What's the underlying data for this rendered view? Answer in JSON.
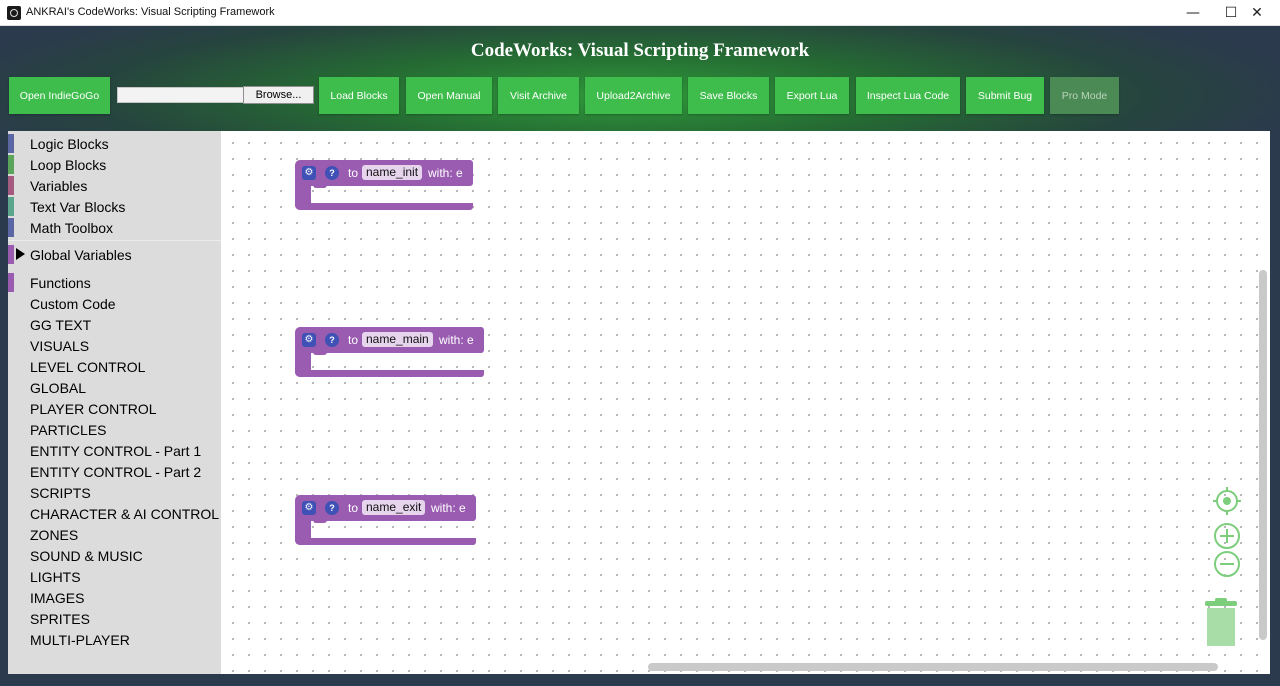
{
  "window": {
    "title": "ANKRAI's  CodeWorks: Visual Scripting Framework",
    "minimize": "—",
    "maximize": "☐",
    "close": "✕"
  },
  "header": {
    "title": "CodeWorks: Visual Scripting Framework"
  },
  "toolbar": {
    "open_indiegogo": "Open IndieGoGo",
    "file_value": "",
    "browse": "Browse...",
    "load_blocks": "Load Blocks",
    "open_manual": "Open Manual",
    "visit_archive": "Visit Archive",
    "upload2archive": "Upload2Archive",
    "save_blocks": "Save Blocks",
    "export_lua": "Export Lua",
    "inspect_lua": "Inspect Lua Code",
    "submit_bug": "Submit Bug",
    "pro_mode": "Pro Mode"
  },
  "sidebar": {
    "items": [
      {
        "label": "Logic Blocks",
        "color": "#5b67a5"
      },
      {
        "label": "Loop Blocks",
        "color": "#5ba55b"
      },
      {
        "label": "Variables",
        "color": "#a55b80"
      },
      {
        "label": "Text Var Blocks",
        "color": "#5ba58c"
      },
      {
        "label": "Math Toolbox",
        "color": "#5b67a5"
      },
      {
        "label": "Global Variables",
        "color": ""
      },
      {
        "label": "Functions",
        "color": "#9a5cb0"
      },
      {
        "label": "Custom Code",
        "color": ""
      },
      {
        "label": "GG TEXT",
        "color": ""
      },
      {
        "label": "VISUALS",
        "color": ""
      },
      {
        "label": "LEVEL CONTROL",
        "color": ""
      },
      {
        "label": "GLOBAL",
        "color": ""
      },
      {
        "label": "PLAYER CONTROL",
        "color": ""
      },
      {
        "label": "PARTICLES",
        "color": ""
      },
      {
        "label": "ENTITY CONTROL - Part 1",
        "color": ""
      },
      {
        "label": "ENTITY CONTROL - Part 2",
        "color": ""
      },
      {
        "label": "SCRIPTS",
        "color": ""
      },
      {
        "label": "CHARACTER & AI CONTROL",
        "color": ""
      },
      {
        "label": "ZONES",
        "color": ""
      },
      {
        "label": "SOUND & MUSIC",
        "color": ""
      },
      {
        "label": "LIGHTS",
        "color": ""
      },
      {
        "label": "IMAGES",
        "color": ""
      },
      {
        "label": "SPRITES",
        "color": ""
      },
      {
        "label": "MULTI-PLAYER",
        "color": ""
      }
    ]
  },
  "blocks": [
    {
      "keyword": "to",
      "name": "name_init",
      "with": "with: e",
      "icon_gear": "gear-icon",
      "icon_help": "help-icon"
    },
    {
      "keyword": "to",
      "name": "name_main",
      "with": "with: e",
      "icon_gear": "gear-icon",
      "icon_help": "help-icon"
    },
    {
      "keyword": "to",
      "name": "name_exit",
      "with": "with: e",
      "icon_gear": "gear-icon",
      "icon_help": "help-icon"
    }
  ],
  "workspace_controls": {
    "recenter": "target-icon",
    "zoom_in": "plus-circle-icon",
    "zoom_out": "minus-circle-icon",
    "trash": "trash-icon"
  },
  "colors": {
    "button_green": "#3fbd4c",
    "button_disabled": "#4c8a55",
    "procedure_purple": "#9a5cb0",
    "control_green": "#7ccd7c"
  }
}
